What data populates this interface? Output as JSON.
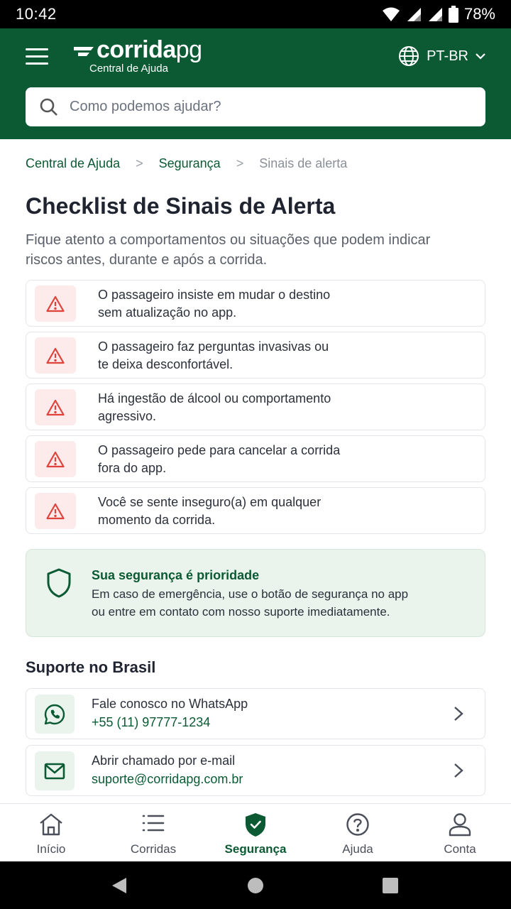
{
  "status_bar": {
    "time": "10:42",
    "battery": "78%"
  },
  "header": {
    "logo_main": "corrida",
    "logo_suffix": "pg",
    "logo_subtitle": "Central de Ajuda",
    "language": "PT-BR",
    "search_placeholder": "Como podemos ajudar?"
  },
  "breadcrumb": {
    "items": [
      "Central de Ajuda",
      "Segurança"
    ],
    "current": "Sinais de alerta"
  },
  "page": {
    "title": "Checklist de Sinais de Alerta",
    "intro": "Fique atento a comportamentos ou situações que podem indicar riscos antes, durante e após a corrida."
  },
  "alerts": [
    {
      "line1": "O passageiro insiste em mudar o destino",
      "line2": "sem atualização no app."
    },
    {
      "line1": "O passageiro faz perguntas invasivas ou",
      "line2": "te deixa desconfortável."
    },
    {
      "line1": "Há ingestão de álcool ou comportamento",
      "line2": "agressivo."
    },
    {
      "line1": "O passageiro pede para cancelar a corrida",
      "line2": "fora do app."
    },
    {
      "line1": "Você se sente inseguro(a) em qualquer",
      "line2": "momento da corrida."
    }
  ],
  "safety_card": {
    "title": "Sua segurança é prioridade",
    "line1": "Em caso de emergência, use o botão de segurança no app",
    "line2": "ou entre em contato com nosso suporte imediatamente."
  },
  "support": {
    "title": "Suporte no Brasil",
    "whatsapp": {
      "label": "Fale conosco no WhatsApp",
      "value": "+55 (11) 97777-1234"
    },
    "email": {
      "label": "Abrir chamado por e-mail",
      "value": "suporte@corridapg.com.br"
    }
  },
  "bottom_nav": {
    "items": [
      "Início",
      "Corridas",
      "Segurança",
      "Ajuda",
      "Conta"
    ],
    "active": "Segurança"
  },
  "colors": {
    "brand_green": "#0b5a33",
    "alert_red": "#e0433b",
    "alert_bg": "#fdeaea",
    "safety_bg": "#eaf4ed"
  },
  "icons": {
    "header": [
      "menu-icon",
      "globe-icon",
      "chevron-down-icon",
      "search-icon"
    ],
    "alerts": "warning-triangle-icon",
    "safety": "shield-icon",
    "support": [
      "whatsapp-icon",
      "mail-icon",
      "chevron-right-icon"
    ],
    "nav": [
      "home-icon",
      "list-icon",
      "shield-check-icon",
      "help-circle-icon",
      "user-icon"
    ]
  }
}
